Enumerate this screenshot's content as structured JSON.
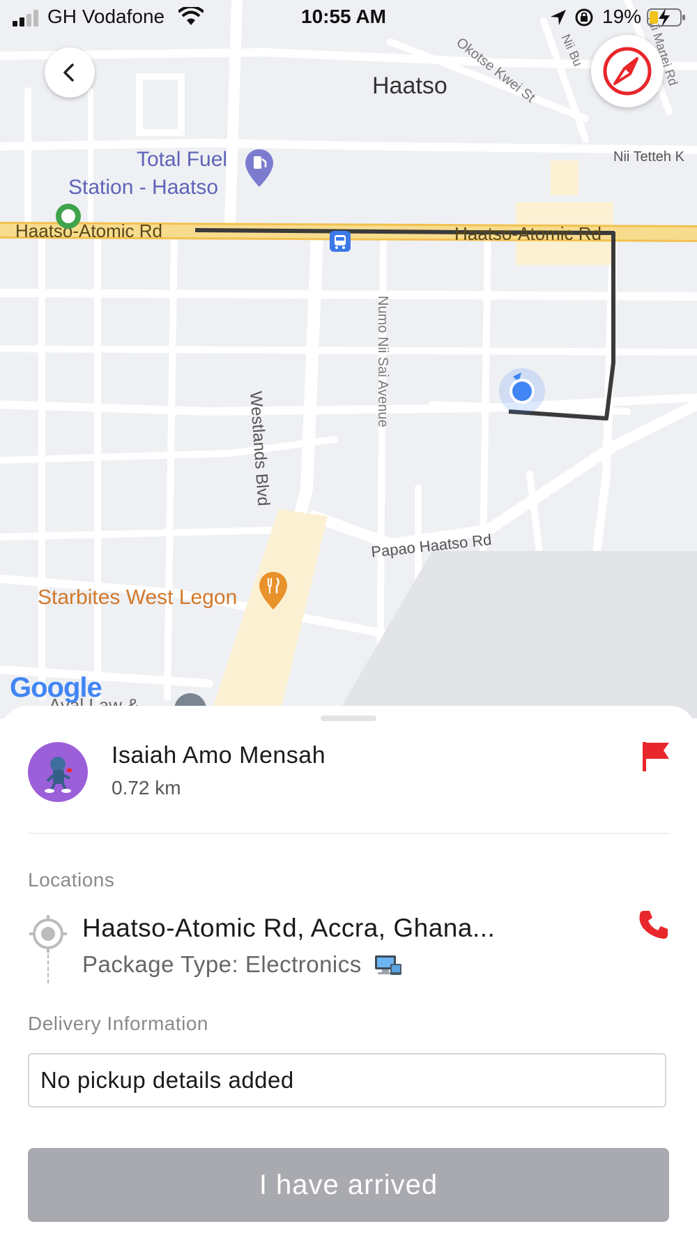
{
  "status_bar": {
    "carrier": "GH Vodafone",
    "time": "10:55 AM",
    "battery_percent": "19%",
    "signal_bars": 2,
    "battery_level": 0.19
  },
  "map": {
    "labels": {
      "haatso": "Haatso",
      "fuel_station": "Total Fuel",
      "fuel_station_line2": "Station - Haatso",
      "road_left": "Haatso-Atomic Rd",
      "road_right": "Haatso-Atomic Rd",
      "westlands": "Westlands Blvd",
      "numo": "Numo Nii Sai Avenue",
      "papao": "Papao Haatso Rd",
      "starbites": "Starbites West Legon",
      "okotse": "Okotse Kwei St",
      "nii_tetteh": "Nii Tetteh K",
      "nii_bu": "Nii Bu",
      "nii_martei": "Nii Martei Rd",
      "law": "Aval Law &",
      "google": "Google"
    },
    "colors": {
      "route": "#3a3a3a",
      "user_dot": "#4285f4",
      "fuel_pin": "#7c7ccf",
      "food_pin": "#e8922c",
      "main_road": "#f6d98a"
    }
  },
  "sheet": {
    "driver_name": "Isaiah Amo Mensah",
    "distance": "0.72 km",
    "locations_label": "Locations",
    "address": "Haatso-Atomic Rd, Accra, Ghana...",
    "package_type": "Package Type: Electronics",
    "delivery_label": "Delivery Information",
    "pickup_details": "No pickup details added",
    "arrive_button": "I have arrived",
    "accent_color": "#e8262b"
  }
}
